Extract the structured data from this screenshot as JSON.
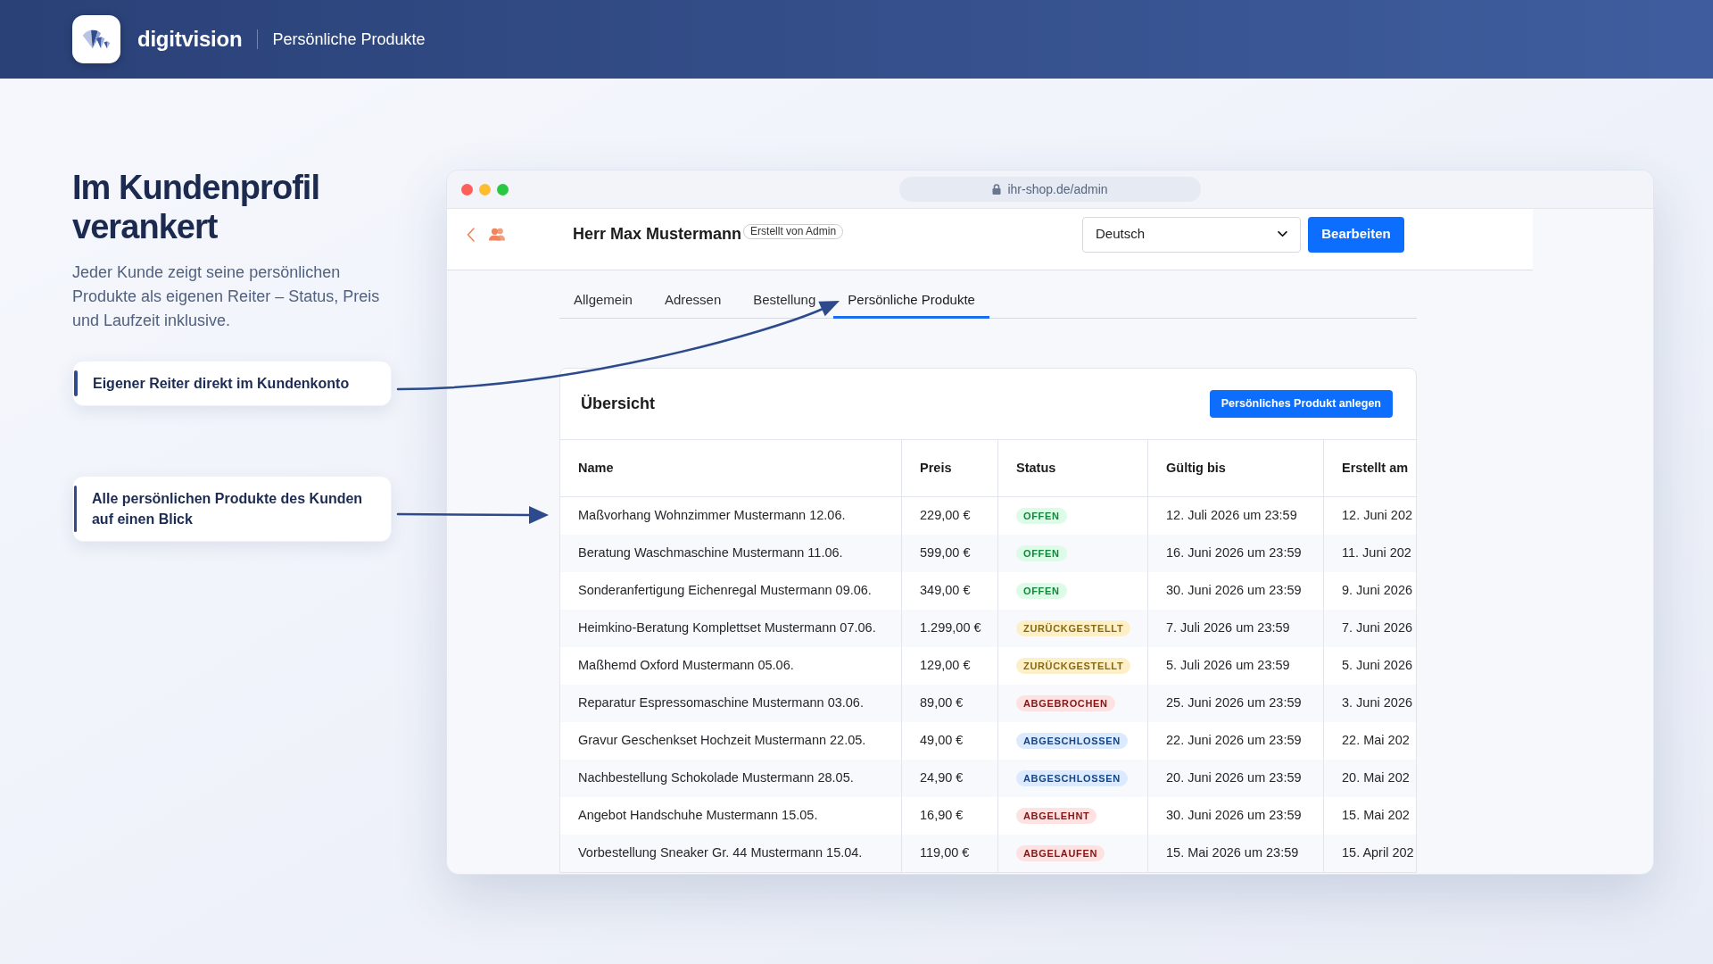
{
  "header": {
    "brand": "digitvision",
    "title": "Persönliche Produkte"
  },
  "intro": {
    "heading": "Im Kundenprofil verankert",
    "text": "Jeder Kunde zeigt seine persönlichen Produkte als eigenen Reiter – Status, Preis und Laufzeit inklusive."
  },
  "callouts": [
    {
      "text": "Eigener Reiter direkt im Kundenkonto"
    },
    {
      "text": "Alle persönlichen Produkte des Kunden auf einen Blick"
    }
  ],
  "browser": {
    "url": "ihr-shop.de/admin"
  },
  "customer": {
    "name": "Herr Max Mustermann",
    "badge": "Erstellt von Admin",
    "language": "Deutsch",
    "edit_button": "Bearbeiten"
  },
  "tabs": [
    {
      "label": "Allgemein",
      "selected": false
    },
    {
      "label": "Adressen",
      "selected": false
    },
    {
      "label": "Bestellung",
      "selected": false
    },
    {
      "label": "Persönliche Produkte",
      "selected": true
    }
  ],
  "overview": {
    "title": "Übersicht",
    "create_button": "Persönliches Produkt anlegen",
    "columns": [
      "Name",
      "Preis",
      "Status",
      "Gültig bis",
      "Erstellt am"
    ],
    "rows": [
      {
        "name": "Maßvorhang Wohnzimmer Mustermann 12.06.",
        "price": "229,00 €",
        "status": {
          "label": "OFFEN",
          "color": "#dcfce7"
        },
        "valid_until": "12. Juli 2026 um 23:59",
        "created": "12. Juni 202"
      },
      {
        "name": "Beratung Waschmaschine Mustermann 11.06.",
        "price": "599,00 €",
        "status": {
          "label": "OFFEN",
          "color": "#dcfce7"
        },
        "valid_until": "16. Juni 2026 um 23:59",
        "created": "11. Juni 202"
      },
      {
        "name": "Sonderanfertigung Eichenregal Mustermann 09.06.",
        "price": "349,00 €",
        "status": {
          "label": "OFFEN",
          "color": "#dcfce7"
        },
        "valid_until": "30. Juni 2026 um 23:59",
        "created": "9. Juni 2026"
      },
      {
        "name": "Heimkino-Beratung Komplettset Mustermann 07.06.",
        "price": "1.299,00 €",
        "status": {
          "label": "ZURÜCKGESTELLT",
          "color": "#fdf0c8"
        },
        "valid_until": "7. Juli 2026 um 23:59",
        "created": "7. Juni 2026"
      },
      {
        "name": "Maßhemd Oxford Mustermann 05.06.",
        "price": "129,00 €",
        "status": {
          "label": "ZURÜCKGESTELLT",
          "color": "#fdf0c8"
        },
        "valid_until": "5. Juli 2026 um 23:59",
        "created": "5. Juni 2026"
      },
      {
        "name": "Reparatur Espressomaschine Mustermann 03.06.",
        "price": "89,00 €",
        "status": {
          "label": "ABGEBROCHEN",
          "color": "#fee2e2"
        },
        "valid_until": "25. Juni 2026 um 23:59",
        "created": "3. Juni 2026"
      },
      {
        "name": "Gravur Geschenkset Hochzeit Mustermann 22.05.",
        "price": "49,00 €",
        "status": {
          "label": "ABGESCHLOSSEN",
          "color": "#dbeafe"
        },
        "valid_until": "22. Juni 2026 um 23:59",
        "created": "22. Mai 202"
      },
      {
        "name": "Nachbestellung Schokolade Mustermann 28.05.",
        "price": "24,90 €",
        "status": {
          "label": "ABGESCHLOSSEN",
          "color": "#dbeafe"
        },
        "valid_until": "20. Juni 2026 um 23:59",
        "created": "20. Mai 202"
      },
      {
        "name": "Angebot Handschuhe Mustermann 15.05.",
        "price": "16,90 €",
        "status": {
          "label": "ABGELEHNT",
          "color": "#fee2e2"
        },
        "valid_until": "30. Juni 2026 um 23:59",
        "created": "15. Mai 202"
      },
      {
        "name": "Vorbestellung Sneaker Gr. 44 Mustermann 15.04.",
        "price": "119,00 €",
        "status": {
          "label": "ABGELAUFEN",
          "color": "#fee2e2"
        },
        "valid_until": "15. Mai 2026 um 23:59",
        "created": "15. April 202"
      }
    ]
  }
}
